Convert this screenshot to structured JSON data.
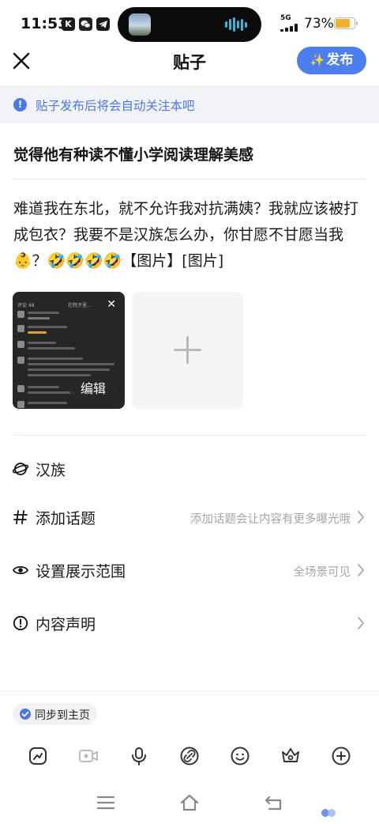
{
  "status_bar": {
    "time": "11:53",
    "app_icons": [
      "K",
      "wechat-icon",
      "telegram-icon"
    ],
    "signal": "5G",
    "battery_percent": "73%",
    "battery_level": 0.73,
    "battery_color": "#f2b12a"
  },
  "header": {
    "title": "贴子",
    "publish_label": "发布",
    "accent_color": "#4b7ff0"
  },
  "notice": {
    "text": "贴子发布后将会自动关注本吧",
    "icon": "info-icon",
    "color": "#4a78e6"
  },
  "post": {
    "title": "觉得他有种读不懂小学阅读理解美感",
    "body": "难道我在东北，就不允许我对抗满姨？我就应该被打成包衣？我要不是汉族怎么办，你甘愿不甘愿当我👶？🤣🤣🤣🤣【图片】[图片]"
  },
  "images": {
    "edit_label": "编辑",
    "thumb_header": "评论 48",
    "thumb_snippet": "在院子里…"
  },
  "options": {
    "forum": {
      "label": "汉族",
      "icon": "forum-icon"
    },
    "topic": {
      "label": "添加话题",
      "hint": "添加话题会让内容有更多曝光哦",
      "icon": "hashtag-icon"
    },
    "visibility": {
      "label": "设置展示范围",
      "value": "全场景可见",
      "icon": "eye-icon"
    },
    "declaration": {
      "label": "内容声明",
      "icon": "alert-circle-icon"
    }
  },
  "sync": {
    "label": "同步到主页",
    "checked": true
  },
  "toolbar": [
    "sticker-icon",
    "video-icon",
    "microphone-icon",
    "link-icon",
    "emoji-icon",
    "crown-icon",
    "add-icon"
  ],
  "nav": [
    "menu-icon",
    "home-icon",
    "back-icon"
  ]
}
